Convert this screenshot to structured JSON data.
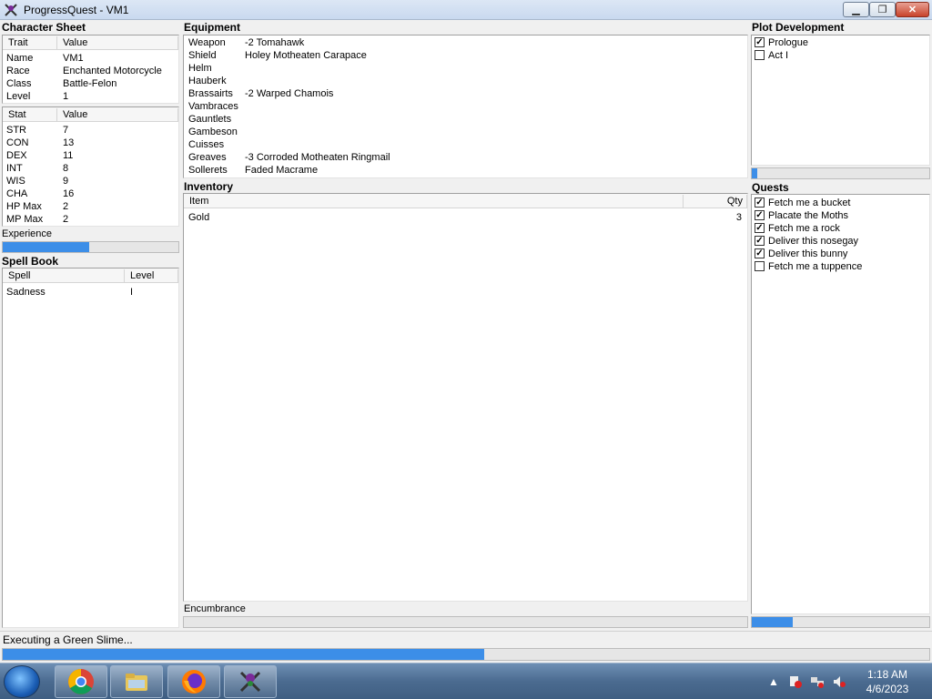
{
  "window": {
    "title": "ProgressQuest - VM1",
    "min": "▁",
    "max": "❐",
    "close": "✕"
  },
  "character_sheet": {
    "title": "Character Sheet",
    "trait_headers": [
      "Trait",
      "Value"
    ],
    "traits": [
      {
        "k": "Name",
        "v": "VM1"
      },
      {
        "k": "Race",
        "v": "Enchanted Motorcycle"
      },
      {
        "k": "Class",
        "v": "Battle-Felon"
      },
      {
        "k": "Level",
        "v": "1"
      }
    ],
    "stat_headers": [
      "Stat",
      "Value"
    ],
    "stats": [
      {
        "k": "STR",
        "v": "7"
      },
      {
        "k": "CON",
        "v": "13"
      },
      {
        "k": "DEX",
        "v": "11"
      },
      {
        "k": "INT",
        "v": "8"
      },
      {
        "k": "WIS",
        "v": "9"
      },
      {
        "k": "CHA",
        "v": "16"
      },
      {
        "k": "HP Max",
        "v": "2"
      },
      {
        "k": "MP Max",
        "v": "2"
      }
    ],
    "experience_label": "Experience",
    "experience_progress": 0.49
  },
  "spell_book": {
    "title": "Spell Book",
    "headers": [
      "Spell",
      "Level"
    ],
    "spells": [
      {
        "k": "Sadness",
        "v": "I"
      }
    ]
  },
  "equipment": {
    "title": "Equipment",
    "items": [
      {
        "k": "Weapon",
        "v": "-2 Tomahawk"
      },
      {
        "k": "Shield",
        "v": "Holey Motheaten Carapace"
      },
      {
        "k": "Helm",
        "v": ""
      },
      {
        "k": "Hauberk",
        "v": ""
      },
      {
        "k": "Brassairts",
        "v": "-2 Warped Chamois"
      },
      {
        "k": "Vambraces",
        "v": ""
      },
      {
        "k": "Gauntlets",
        "v": ""
      },
      {
        "k": "Gambeson",
        "v": ""
      },
      {
        "k": "Cuisses",
        "v": ""
      },
      {
        "k": "Greaves",
        "v": "-3 Corroded Motheaten Ringmail"
      },
      {
        "k": "Sollerets",
        "v": "Faded Macrame"
      }
    ]
  },
  "inventory": {
    "title": "Inventory",
    "headers": [
      "Item",
      "Qty"
    ],
    "items": [
      {
        "k": "Gold",
        "v": "3"
      }
    ],
    "encumbrance_label": "Encumbrance",
    "encumbrance_progress": 0.0
  },
  "plot": {
    "title": "Plot Development",
    "acts": [
      {
        "label": "Prologue",
        "checked": true
      },
      {
        "label": "Act I",
        "checked": false
      }
    ],
    "progress": 0.03
  },
  "quests": {
    "title": "Quests",
    "items": [
      {
        "label": "Fetch me a bucket",
        "checked": true
      },
      {
        "label": "Placate the Moths",
        "checked": true
      },
      {
        "label": "Fetch me a rock",
        "checked": true
      },
      {
        "label": "Deliver this nosegay",
        "checked": true
      },
      {
        "label": "Deliver this bunny",
        "checked": true
      },
      {
        "label": "Fetch me a tuppence",
        "checked": false
      }
    ],
    "progress": 0.23
  },
  "status": {
    "text": "Executing a Green Slime...",
    "progress": 0.52
  },
  "taskbar": {
    "apps": [
      "chrome-icon",
      "file-explorer-icon",
      "firefox-icon",
      "progressquest-icon"
    ],
    "tray_arrow": "▲",
    "time": "1:18 AM",
    "date": "4/6/2023"
  },
  "colors": {
    "progress": "#3c8ee8",
    "taskbar": "#4b6b90"
  }
}
